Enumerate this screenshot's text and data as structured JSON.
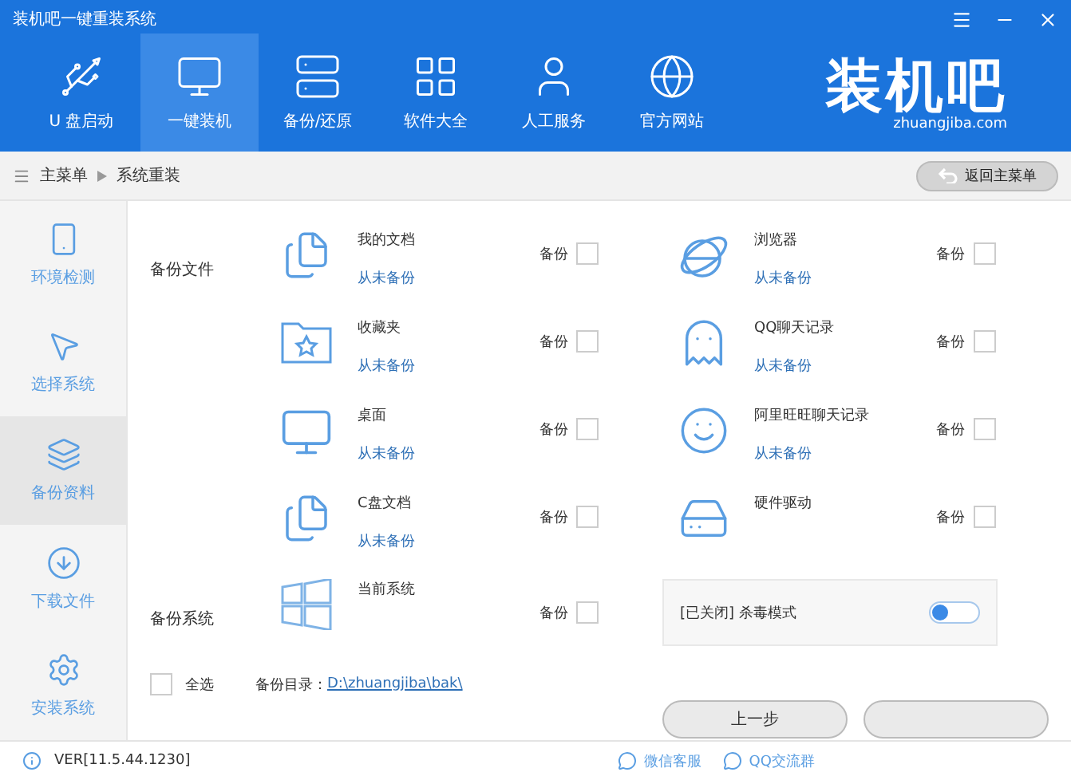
{
  "window": {
    "title": "装机吧一键重装系统"
  },
  "nav": {
    "items": [
      {
        "label": "U 盘启动",
        "selected": false
      },
      {
        "label": "一键装机",
        "selected": true
      },
      {
        "label": "备份/还原",
        "selected": false
      },
      {
        "label": "软件大全",
        "selected": false
      },
      {
        "label": "人工服务",
        "selected": false
      },
      {
        "label": "官方网站",
        "selected": false
      }
    ]
  },
  "logo": {
    "name": "装机吧",
    "site": "zhuangjiba.com"
  },
  "breadcrumb": {
    "items": [
      "主菜单",
      "系统重装"
    ],
    "back_button": "返回主菜单"
  },
  "sidebar": {
    "items": [
      {
        "label": "环境检测",
        "selected": false
      },
      {
        "label": "选择系统",
        "selected": false
      },
      {
        "label": "备份资料",
        "selected": true
      },
      {
        "label": "下载文件",
        "selected": false
      },
      {
        "label": "安装系统",
        "selected": false
      }
    ]
  },
  "backup_files": {
    "label": "备份文件",
    "items": [
      {
        "name": "我的文档",
        "status": "从未备份",
        "option": "备份",
        "checked": false
      },
      {
        "name": "浏览器",
        "status": "从未备份",
        "option": "备份",
        "checked": false
      },
      {
        "name": "收藏夹",
        "status": "从未备份",
        "option": "备份",
        "checked": false
      },
      {
        "name": "QQ聊天记录",
        "status": "从未备份",
        "option": "备份",
        "checked": false
      },
      {
        "name": "桌面",
        "status": "从未备份",
        "option": "备份",
        "checked": false
      },
      {
        "name": "阿里旺旺聊天记录",
        "status": "从未备份",
        "option": "备份",
        "checked": false
      },
      {
        "name": "C盘文档",
        "status": "从未备份",
        "option": "备份",
        "checked": false
      },
      {
        "name": "硬件驱动",
        "option": "备份",
        "checked": false
      }
    ]
  },
  "backup_system": {
    "label": "备份系统",
    "name": "当前系统",
    "option": "备份",
    "checked": false
  },
  "antivirus": {
    "label": "[已关闭] 杀毒模式",
    "on": false
  },
  "select_all": {
    "label": "全选",
    "checked": false
  },
  "backup_dir": {
    "label": "备份目录：",
    "path": "D:\\zhuangjiba\\bak\\"
  },
  "step_buttons": [
    {
      "kind": "labeled",
      "label": "上一步"
    },
    {
      "kind": "blank"
    }
  ],
  "footer": {
    "version": "VER[11.5.44.1230]",
    "links": [
      "微信客服",
      "QQ交流群"
    ]
  }
}
